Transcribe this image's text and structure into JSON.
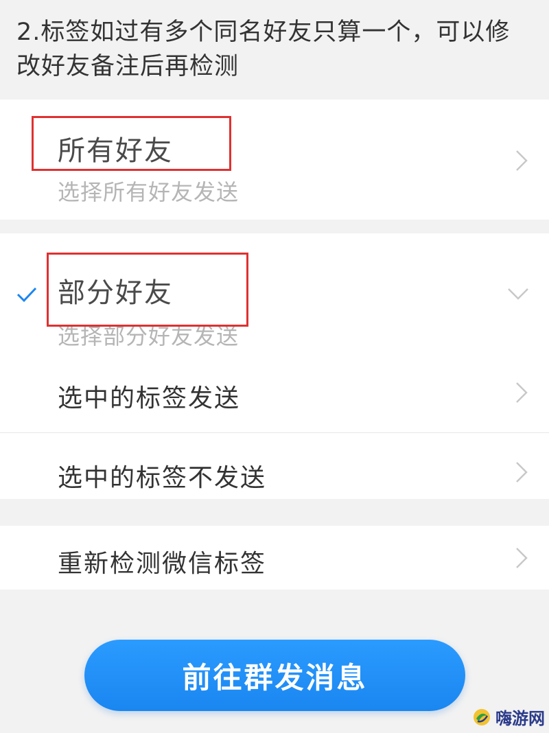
{
  "notice": "2.标签如过有多个同名好友只算一个，可以修改好友备注后再检测",
  "options": {
    "all_friends": {
      "title": "所有好友",
      "subtitle": "选择所有好友发送"
    },
    "some_friends": {
      "title": "部分好友",
      "subtitle": "选择部分好友发送",
      "selected": true
    }
  },
  "sub_options": [
    {
      "label": "选中的标签发送"
    },
    {
      "label": "选中的标签不发送"
    }
  ],
  "recheck_label": "重新检测微信标签",
  "cta_label": "前往群发消息",
  "watermark": "嗨游网",
  "colors": {
    "accent": "#1a86f0",
    "highlight_box": "#e03030",
    "check": "#1a86f0"
  }
}
